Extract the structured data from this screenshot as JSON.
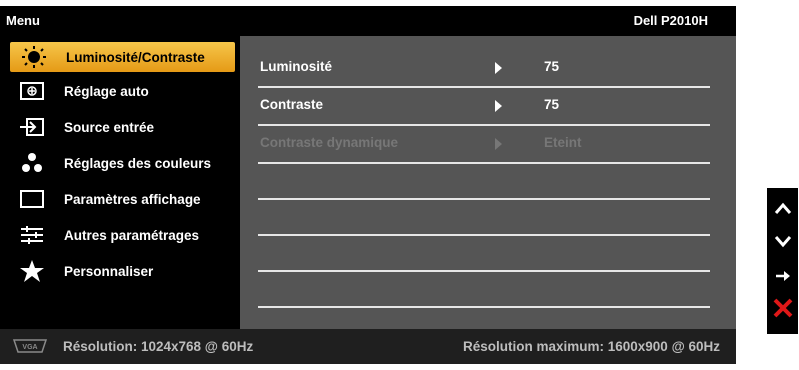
{
  "header": {
    "menu_title": "Menu",
    "model": "Dell P2010H"
  },
  "sidebar": {
    "items": [
      {
        "label": "Luminosité/Contraste",
        "icon": "sun-icon",
        "selected": true
      },
      {
        "label": "Réglage auto",
        "icon": "auto-adjust-icon",
        "selected": false
      },
      {
        "label": "Source entrée",
        "icon": "input-source-icon",
        "selected": false
      },
      {
        "label": "Réglages des couleurs",
        "icon": "color-dots-icon",
        "selected": false
      },
      {
        "label": "Paramètres affichage",
        "icon": "display-rectangle-icon",
        "selected": false
      },
      {
        "label": "Autres paramétrages",
        "icon": "settings-sliders-icon",
        "selected": false
      },
      {
        "label": "Personnaliser",
        "icon": "star-icon",
        "selected": false
      }
    ]
  },
  "panel": {
    "rows": [
      {
        "label": "Luminosité",
        "value": "75",
        "enabled": true
      },
      {
        "label": "Contraste",
        "value": "75",
        "enabled": true
      },
      {
        "label": "Contraste dynamique",
        "value": "Eteint",
        "enabled": false
      }
    ]
  },
  "status": {
    "resolution": "Résolution: 1024x768 @ 60Hz",
    "max_resolution": "Résolution maximum: 1600x900 @ 60Hz",
    "connector_icon": "vga-connector-icon"
  },
  "buttons": [
    {
      "icon": "up-arrow-icon"
    },
    {
      "icon": "down-arrow-icon"
    },
    {
      "icon": "right-arrow-icon"
    },
    {
      "icon": "exit-x-icon"
    }
  ],
  "colors": {
    "selection_top": "#f6c64a",
    "selection_bottom": "#e59a16",
    "panel_bg": "#555555",
    "exit_red": "#e01818"
  }
}
